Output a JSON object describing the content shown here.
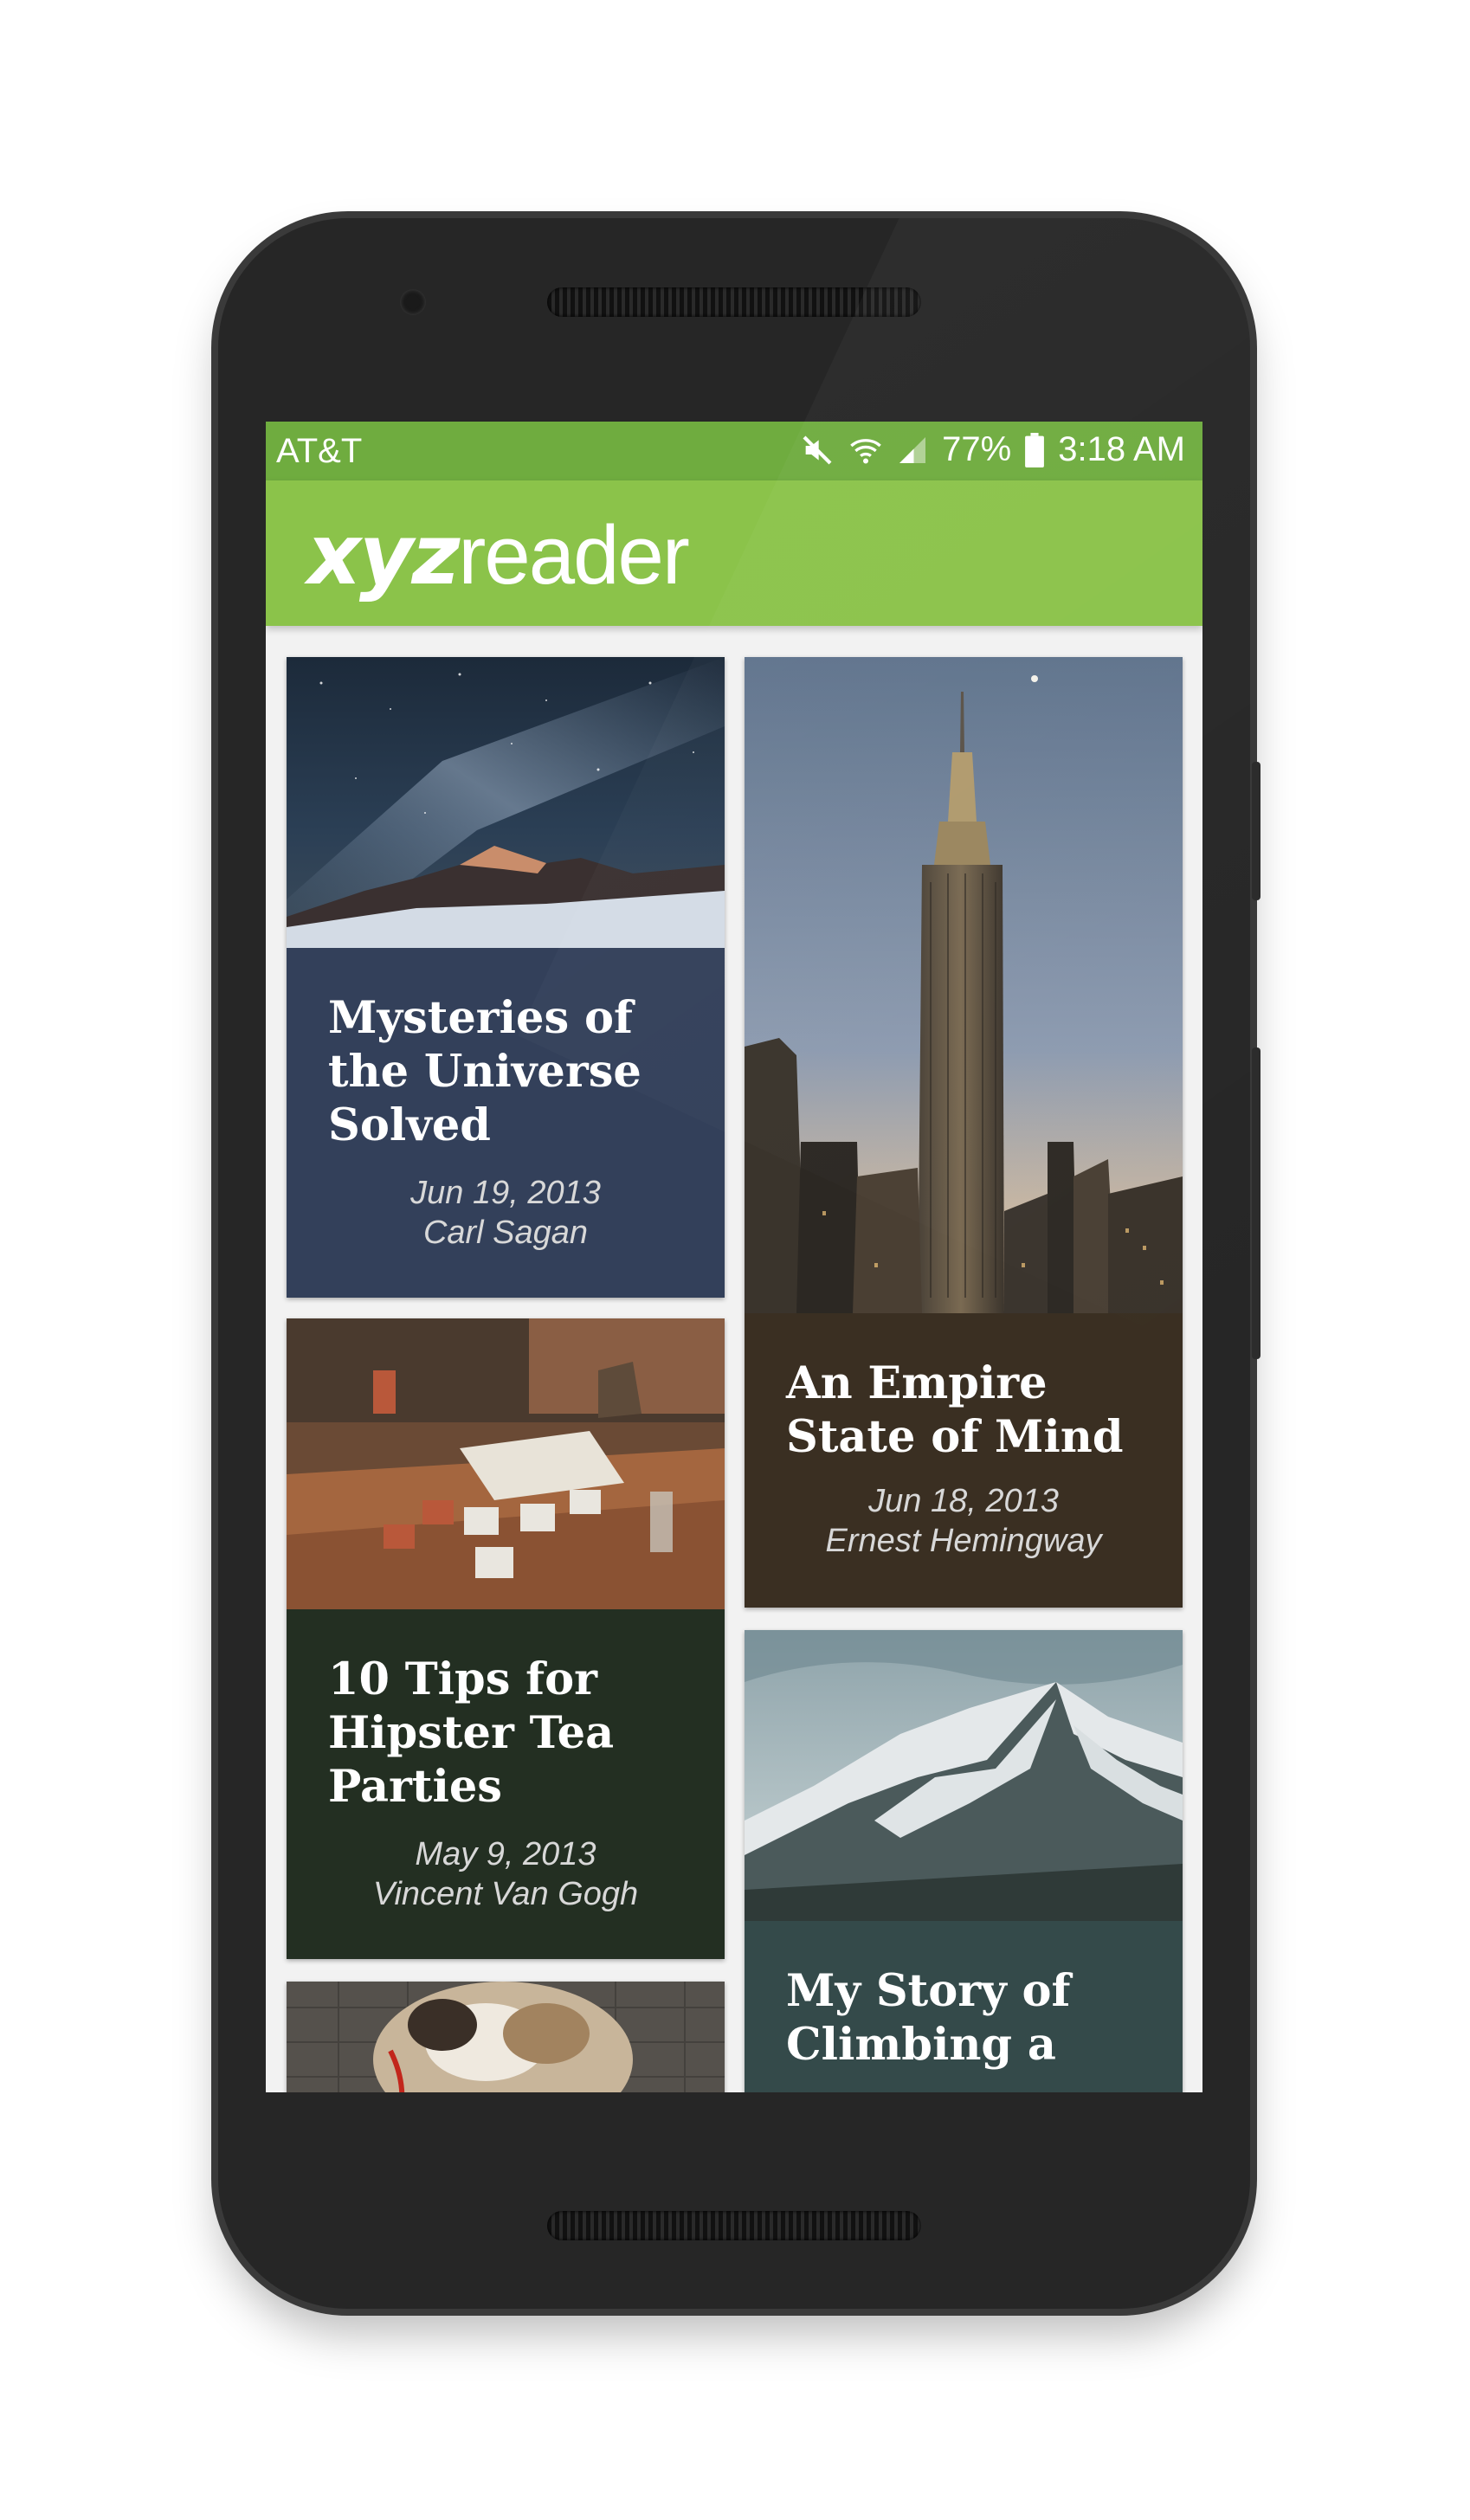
{
  "status_bar": {
    "carrier": "AT&T",
    "battery": "77%",
    "time": "3:18 AM",
    "icons": [
      "mute-icon",
      "wifi-icon",
      "signal-icon",
      "battery-icon"
    ]
  },
  "app_bar": {
    "logo_bold": "xyz",
    "logo_light": "reader",
    "color": "#8bc34a",
    "status_color": "#6fac3f"
  },
  "articles": [
    {
      "title": "Mysteries of the Universe Solved",
      "date": "Jun 19, 2013",
      "author": "Carl Sagan",
      "color": "#33405a",
      "image": "night-sky-mountain"
    },
    {
      "title": "An Empire State of Mind",
      "date": "Jun 18, 2013",
      "author": "Ernest Hemingway",
      "color": "#3a2f22",
      "image": "empire-state-building"
    },
    {
      "title": "10 Tips for Hipster Tea Parties",
      "date": "May 9, 2013",
      "author": "Vincent Van Gogh",
      "color": "#232f22",
      "image": "tea-cups-on-table"
    },
    {
      "title": "My Story of Climbing a",
      "date": "",
      "author": "",
      "color": "#344a4a",
      "image": "snowy-mountain"
    },
    {
      "title": "",
      "date": "",
      "author": "",
      "color": "#5a5a5a",
      "image": "bulldog"
    }
  ]
}
